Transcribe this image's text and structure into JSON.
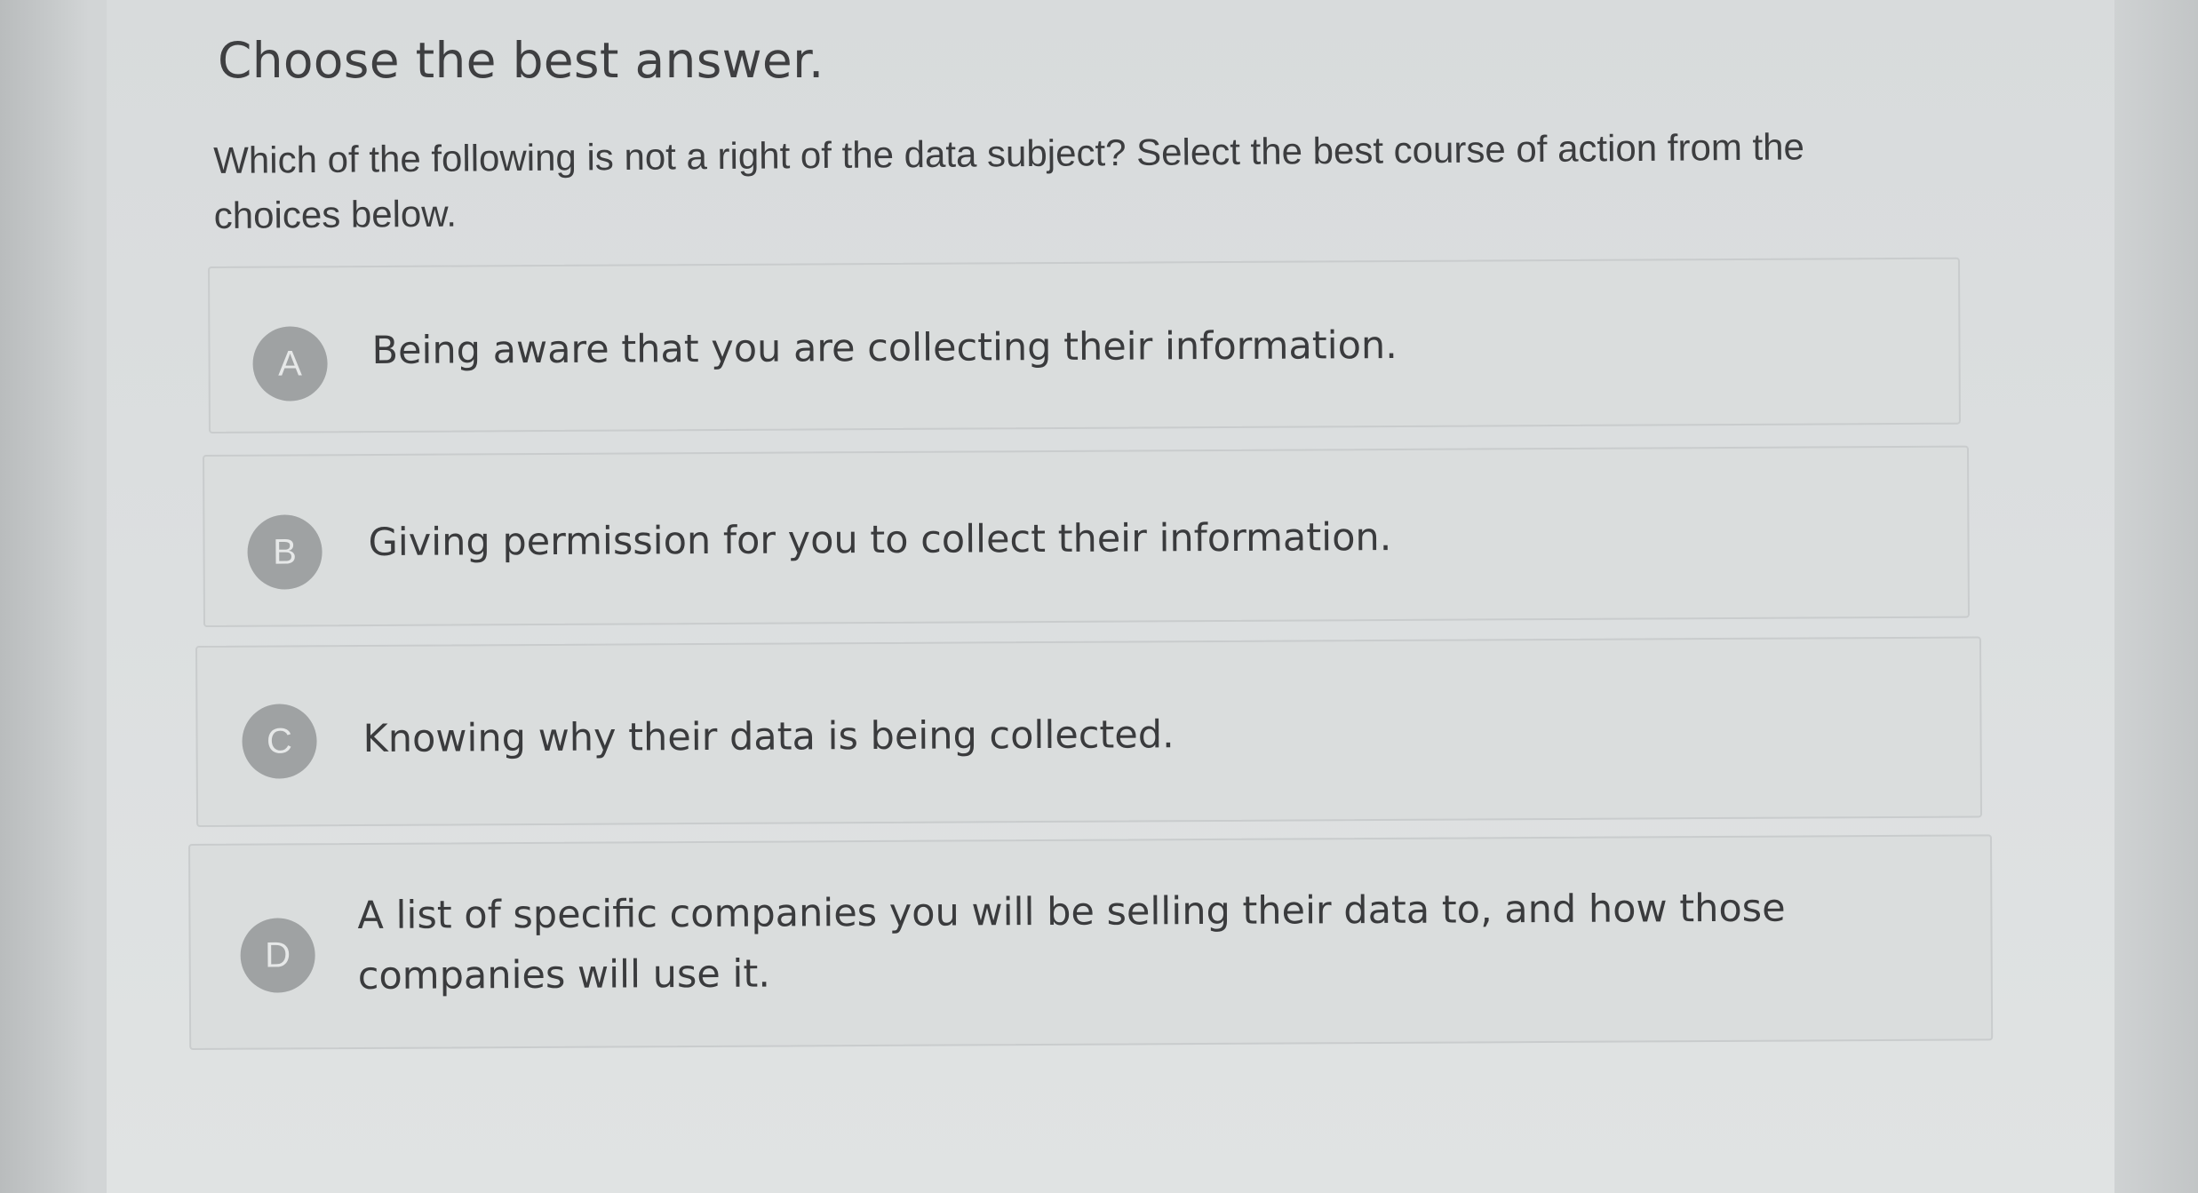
{
  "instruction": "Choose the best answer.",
  "question": "Which of the following is not a right of the data subject? Select the best course of action from the choices below.",
  "choices": [
    {
      "letter": "A",
      "text": "Being aware that you are collecting their information."
    },
    {
      "letter": "B",
      "text": "Giving permission for you to collect their information."
    },
    {
      "letter": "C",
      "text": "Knowing why their data is being collected."
    },
    {
      "letter": "D",
      "text": "A list of specific companies you will be selling their data to, and how those companies will use it."
    }
  ]
}
